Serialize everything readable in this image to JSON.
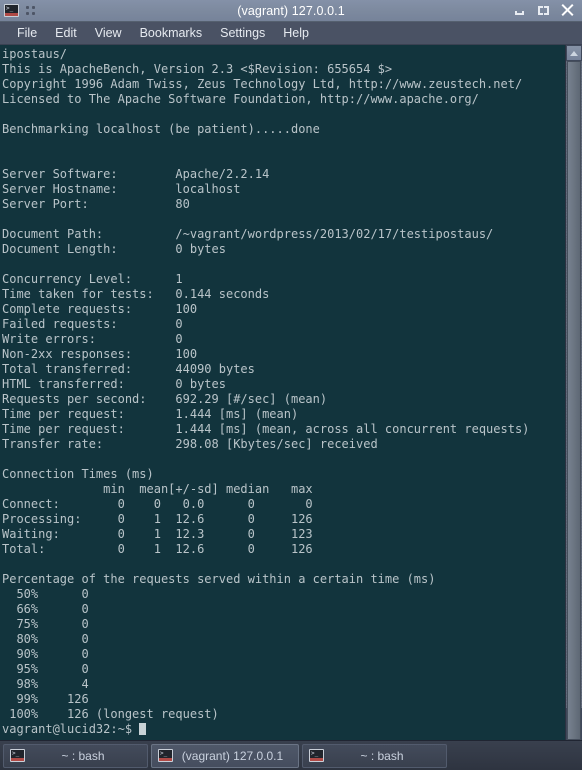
{
  "window": {
    "title": "(vagrant) 127.0.0.1",
    "app_icon": "terminal-icon",
    "grid_icon": "window-menu-icon",
    "controls": {
      "minimize": "minimize-icon",
      "maximize": "maximize-icon",
      "close": "close-icon"
    }
  },
  "menubar": {
    "items": [
      {
        "label": "File"
      },
      {
        "label": "Edit"
      },
      {
        "label": "View"
      },
      {
        "label": "Bookmarks"
      },
      {
        "label": "Settings"
      },
      {
        "label": "Help"
      }
    ]
  },
  "terminal": {
    "background_color": "#12343d",
    "foreground_color": "#b9c4c9",
    "prompt": "vagrant@lucid32:~$ ",
    "lines": [
      "ipostaus/",
      "This is ApacheBench, Version 2.3 <$Revision: 655654 $>",
      "Copyright 1996 Adam Twiss, Zeus Technology Ltd, http://www.zeustech.net/",
      "Licensed to The Apache Software Foundation, http://www.apache.org/",
      "",
      "Benchmarking localhost (be patient).....done",
      "",
      "",
      "Server Software:        Apache/2.2.14",
      "Server Hostname:        localhost",
      "Server Port:            80",
      "",
      "Document Path:          /~vagrant/wordpress/2013/02/17/testipostaus/",
      "Document Length:        0 bytes",
      "",
      "Concurrency Level:      1",
      "Time taken for tests:   0.144 seconds",
      "Complete requests:      100",
      "Failed requests:        0",
      "Write errors:           0",
      "Non-2xx responses:      100",
      "Total transferred:      44090 bytes",
      "HTML transferred:       0 bytes",
      "Requests per second:    692.29 [#/sec] (mean)",
      "Time per request:       1.444 [ms] (mean)",
      "Time per request:       1.444 [ms] (mean, across all concurrent requests)",
      "Transfer rate:          298.08 [Kbytes/sec] received",
      "",
      "Connection Times (ms)",
      "              min  mean[+/-sd] median   max",
      "Connect:        0    0   0.0      0       0",
      "Processing:     0    1  12.6      0     126",
      "Waiting:        0    1  12.3      0     123",
      "Total:          0    1  12.6      0     126",
      "",
      "Percentage of the requests served within a certain time (ms)",
      "  50%      0",
      "  66%      0",
      "  75%      0",
      "  80%      0",
      "  90%      0",
      "  95%      0",
      "  98%      4",
      "  99%    126",
      " 100%    126 (longest request)"
    ]
  },
  "scrollbar": {
    "up_arrow": "scroll-up-icon",
    "down_arrow": "scroll-down-icon"
  },
  "taskbar": {
    "buttons": [
      {
        "label": "~ : bash",
        "icon": "terminal-icon",
        "active": false
      },
      {
        "label": "(vagrant) 127.0.0.1",
        "icon": "terminal-icon",
        "active": true
      },
      {
        "label": "~ : bash",
        "icon": "terminal-icon",
        "active": false
      }
    ]
  }
}
